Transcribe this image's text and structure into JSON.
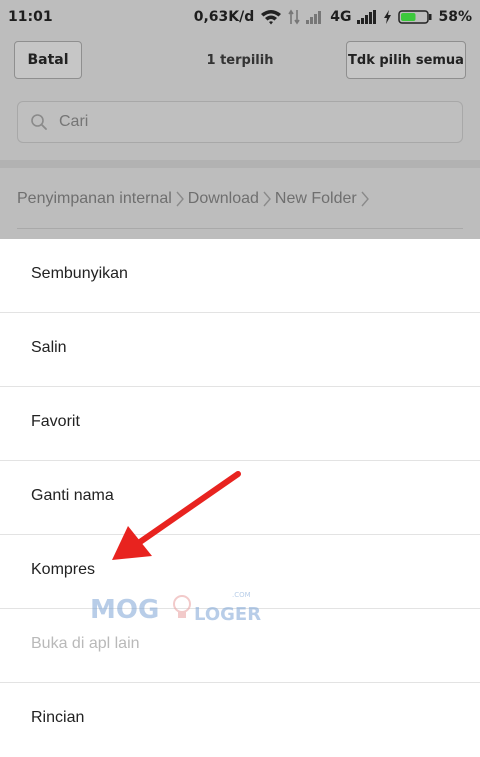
{
  "status_bar": {
    "time": "11:01",
    "speed": "0,63K/d",
    "network": "4G",
    "battery": "58%",
    "battery_level": 0.58
  },
  "action_bar": {
    "cancel_label": "Batal",
    "title": "1 terpilih",
    "deselect_all_label": "Tdk pilih semua"
  },
  "search": {
    "placeholder": "Cari"
  },
  "breadcrumb": {
    "items": [
      "Penyimpanan internal",
      "Download",
      "New Folder"
    ]
  },
  "menu": {
    "items": [
      {
        "label": "Sembunyikan",
        "enabled": true
      },
      {
        "label": "Salin",
        "enabled": true
      },
      {
        "label": "Favorit",
        "enabled": true
      },
      {
        "label": "Ganti nama",
        "enabled": true
      },
      {
        "label": "Kompres",
        "enabled": true
      },
      {
        "label": "Buka di apl lain",
        "enabled": false
      },
      {
        "label": "Rincian",
        "enabled": true
      }
    ]
  },
  "watermark": {
    "text_left": "MOG",
    "text_right": "LOGER",
    "suffix": ".COM"
  },
  "colors": {
    "dim_background": "#bdbdbd",
    "battery_fill": "#3cc93c",
    "annotation_arrow": "#e8231f"
  }
}
